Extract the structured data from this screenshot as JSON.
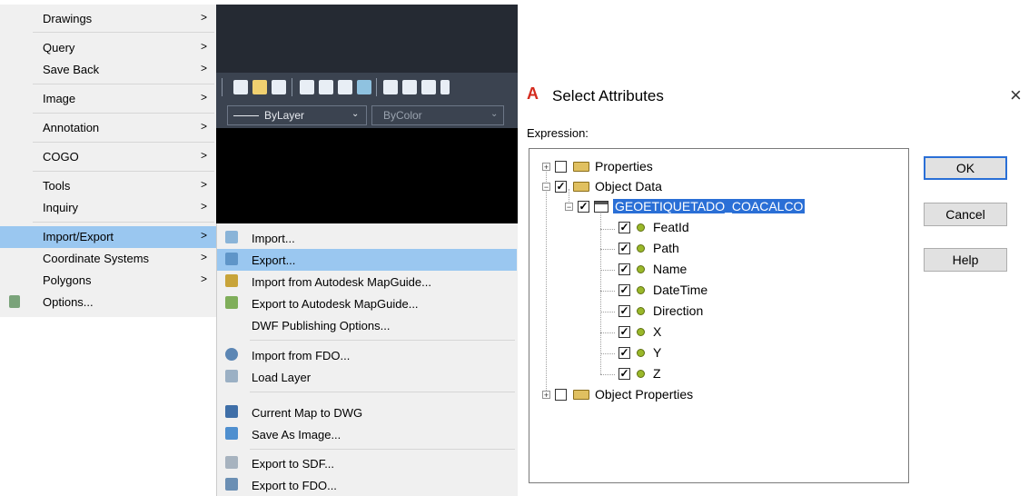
{
  "menu_main": {
    "items": [
      {
        "label": "Drawings",
        "arrow": ">"
      },
      {
        "label": "Query",
        "arrow": ">"
      },
      {
        "label": "Save Back",
        "arrow": ">"
      },
      {
        "label": "Image",
        "arrow": ">"
      },
      {
        "label": "Annotation",
        "arrow": ">"
      },
      {
        "label": "COGO",
        "arrow": ">"
      },
      {
        "label": "Tools",
        "arrow": ">"
      },
      {
        "label": "Inquiry",
        "arrow": ">"
      },
      {
        "label": "Import/Export",
        "arrow": ">"
      },
      {
        "label": "Coordinate Systems",
        "arrow": ">"
      },
      {
        "label": "Polygons",
        "arrow": ">"
      },
      {
        "label": "Options...",
        "arrow": ""
      }
    ]
  },
  "menu_sub": {
    "items": [
      {
        "label": "Import...",
        "icon": "import-icon"
      },
      {
        "label": "Export...",
        "icon": "export-icon"
      },
      {
        "label": "Import from Autodesk MapGuide...",
        "icon": "mapguide-import-icon"
      },
      {
        "label": "Export to Autodesk MapGuide...",
        "icon": "mapguide-export-icon"
      },
      {
        "label": "DWF Publishing Options...",
        "icon": ""
      },
      {
        "label": "Import from FDO...",
        "icon": "fdo-import-icon"
      },
      {
        "label": "Load Layer",
        "icon": "load-layer-icon"
      },
      {
        "label": "Current Map to DWG",
        "icon": "map-to-dwg-icon"
      },
      {
        "label": "Save As Image...",
        "icon": "save-image-icon"
      },
      {
        "label": "Export to SDF...",
        "icon": "sdf-export-icon"
      },
      {
        "label": "Export to FDO...",
        "icon": "fdo-export-icon"
      }
    ]
  },
  "toolbar": {
    "linetype": "ByLayer",
    "color": "ByColor"
  },
  "dialog": {
    "title": "Select Attributes",
    "logo": "A",
    "close": "×",
    "expression_label": "Expression:",
    "buttons": {
      "ok": "OK",
      "cancel": "Cancel",
      "help": "Help"
    },
    "tree": {
      "properties": "Properties",
      "object_data": "Object Data",
      "table": "GEOETIQUETADO_COACALCO",
      "fields": [
        "FeatId",
        "Path",
        "Name",
        "DateTime",
        "Direction",
        "X",
        "Y",
        "Z"
      ],
      "object_properties": "Object Properties"
    }
  },
  "colors": {
    "highlight": "#9ac7f0",
    "selection": "#2a6fd6",
    "cad_background": "#000000",
    "logo_red": "#d42b1e"
  }
}
